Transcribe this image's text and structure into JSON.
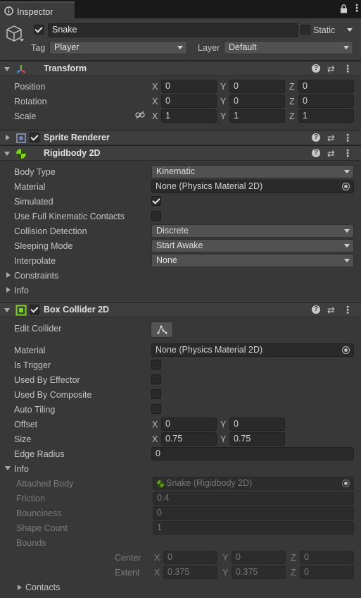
{
  "window": {
    "tab_title": "Inspector"
  },
  "gameobject": {
    "active": true,
    "name": "Snake",
    "static_label": "Static",
    "tag_label": "Tag",
    "tag_value": "Player",
    "layer_label": "Layer",
    "layer_value": "Default"
  },
  "transform": {
    "title": "Transform",
    "position": {
      "label": "Position",
      "x": "0",
      "y": "0",
      "z": "0"
    },
    "rotation": {
      "label": "Rotation",
      "x": "0",
      "y": "0",
      "z": "0"
    },
    "scale": {
      "label": "Scale",
      "x": "1",
      "y": "1",
      "z": "1"
    }
  },
  "axes": {
    "x": "X",
    "y": "Y",
    "z": "Z"
  },
  "sprite_renderer": {
    "title": "Sprite Renderer",
    "enabled": true
  },
  "rigidbody2d": {
    "title": "Rigidbody 2D",
    "body_type": {
      "label": "Body Type",
      "value": "Kinematic"
    },
    "material": {
      "label": "Material",
      "value": "None (Physics Material 2D)"
    },
    "simulated": {
      "label": "Simulated",
      "checked": true
    },
    "full_kinematic": {
      "label": "Use Full Kinematic Contacts",
      "checked": false
    },
    "collision_detection": {
      "label": "Collision Detection",
      "value": "Discrete"
    },
    "sleeping_mode": {
      "label": "Sleeping Mode",
      "value": "Start Awake"
    },
    "interpolate": {
      "label": "Interpolate",
      "value": "None"
    },
    "constraints_label": "Constraints",
    "info_label": "Info"
  },
  "box_collider2d": {
    "title": "Box Collider 2D",
    "enabled": true,
    "edit_collider_label": "Edit Collider",
    "material": {
      "label": "Material",
      "value": "None (Physics Material 2D)"
    },
    "is_trigger": {
      "label": "Is Trigger",
      "checked": false
    },
    "used_by_effector": {
      "label": "Used By Effector",
      "checked": false
    },
    "used_by_composite": {
      "label": "Used By Composite",
      "checked": false
    },
    "auto_tiling": {
      "label": "Auto Tiling",
      "checked": false
    },
    "offset": {
      "label": "Offset",
      "x": "0",
      "y": "0"
    },
    "size": {
      "label": "Size",
      "x": "0.75",
      "y": "0.75"
    },
    "edge_radius": {
      "label": "Edge Radius",
      "value": "0"
    },
    "info": {
      "label": "Info",
      "attached_body": {
        "label": "Attached Body",
        "value": "Snake (Rigidbody 2D)"
      },
      "friction": {
        "label": "Friction",
        "value": "0.4"
      },
      "bounciness": {
        "label": "Bounciness",
        "value": "0"
      },
      "shape_count": {
        "label": "Shape Count",
        "value": "1"
      },
      "bounds_label": "Bounds",
      "center": {
        "label": "Center",
        "x": "0",
        "y": "0",
        "z": "0"
      },
      "extent": {
        "label": "Extent",
        "x": "0.375",
        "y": "0.375",
        "z": "0"
      },
      "contacts_label": "Contacts"
    }
  },
  "colors": {
    "background": "#383838",
    "rigidbody_icon": "#7ed321",
    "collider_icon": "#7ed321"
  },
  "icons": [
    "lock-icon",
    "menu-icon",
    "gameobject-cube-icon",
    "transform-icon",
    "sprite-renderer-icon",
    "rigidbody2d-icon",
    "boxcollider2d-icon",
    "edit-collider-icon",
    "help-icon",
    "presets-icon",
    "context-menu-icon",
    "object-picker-icon"
  ]
}
